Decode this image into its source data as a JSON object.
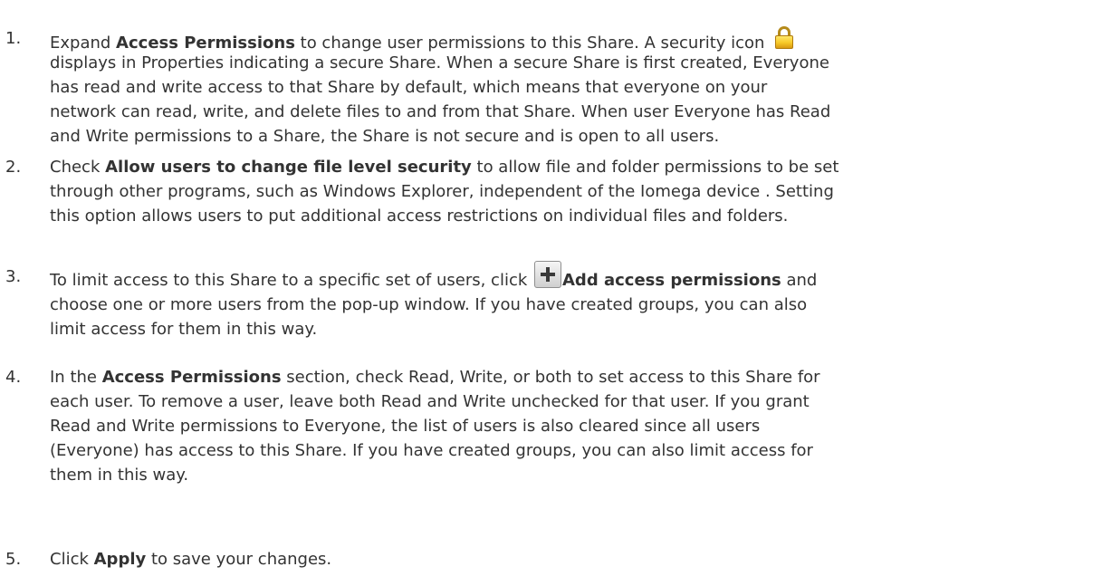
{
  "steps": [
    {
      "number": "1.",
      "lines": [
        [
          "Expand ",
          {
            "b": "Access Permissions"
          },
          " to change user permissions to this Share. A security icon ",
          {
            "icon": "lock-icon"
          }
        ],
        [
          "displays in Properties indicating a secure Share. When a secure Share is first created, Everyone"
        ],
        [
          "has read and write access to that Share by default, which means that everyone on your"
        ],
        [
          "network can read, write, and delete files to and from that Share. When user Everyone has Read"
        ],
        [
          "and Write permissions to a Share, the Share is not secure and is open to all users."
        ]
      ]
    },
    {
      "number": "2.",
      "lines": [
        [
          "Check ",
          {
            "b": "Allow users to change file level security"
          },
          " to allow file and folder permissions to be set"
        ],
        [
          "through other programs, such as Windows Explorer, independent of the Iomega device . Setting"
        ],
        [
          "this option allows users to put additional access restrictions on individual files and folders."
        ]
      ]
    },
    {
      "number": "3.",
      "lines": [
        [
          "To limit access to this Share to a specific set of users, click ",
          {
            "icon": "add-icon"
          },
          {
            "b": "Add access permissions"
          },
          " and"
        ],
        [
          "choose one or more users from the pop-up window. If you have created groups, you can also"
        ],
        [
          "limit access for them in this way."
        ]
      ]
    },
    {
      "number": "4.",
      "lines": [
        [
          "In the ",
          {
            "b": "Access Permissions"
          },
          " section, check Read, Write, or both to set access to this Share for"
        ],
        [
          "each user. To remove a user, leave both Read and Write unchecked for that user. If you grant"
        ],
        [
          "Read and Write permissions to Everyone, the list of users is also cleared since all users"
        ],
        [
          "(Everyone) has access to this Share. If you have created groups, you can also limit access for"
        ],
        [
          "them in this way."
        ]
      ]
    },
    {
      "number": "5.",
      "lines": [
        [
          "Click ",
          {
            "b": "Apply"
          },
          " to save your changes."
        ]
      ]
    }
  ],
  "colors": {
    "text": "#333333",
    "background": "#ffffff",
    "lock_icon": "#f7c928",
    "add_icon": "#cfcfcf"
  }
}
